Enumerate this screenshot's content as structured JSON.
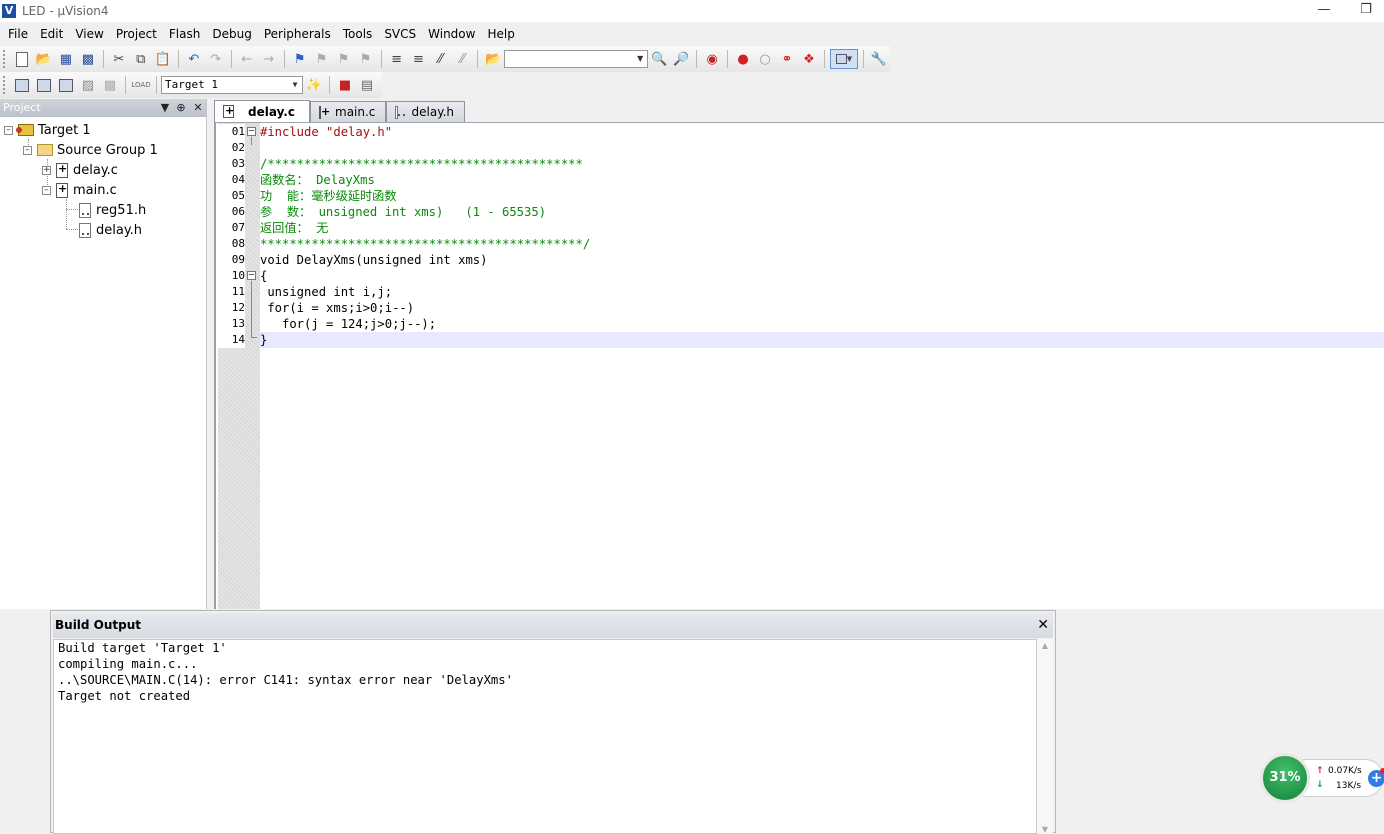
{
  "window": {
    "title": "LED  - µVision4",
    "icon": "uvision-icon"
  },
  "menu": [
    "File",
    "Edit",
    "View",
    "Project",
    "Flash",
    "Debug",
    "Peripherals",
    "Tools",
    "SVCS",
    "Window",
    "Help"
  ],
  "toolbar": {
    "target_select": "Target 1",
    "find_value": ""
  },
  "project": {
    "header": "Project",
    "tree": {
      "target": "Target 1",
      "group": "Source Group 1",
      "files": [
        "delay.c",
        "main.c"
      ],
      "headers": [
        "reg51.h",
        "delay.h"
      ]
    }
  },
  "tabs": [
    "delay.c",
    "main.c",
    "delay.h"
  ],
  "editor": {
    "line_numbers": [
      "01",
      "02",
      "03",
      "04",
      "05",
      "06",
      "07",
      "08",
      "09",
      "10",
      "11",
      "12",
      "13",
      "14"
    ],
    "lines": [
      "#include \"delay.h\"",
      "",
      "/*******************************************",
      "函数名： DelayXms",
      "功  能：毫秒级延时函数",
      "参  数： unsigned int xms)   (1 - 65535)",
      "返回值： 无",
      "********************************************/",
      "void DelayXms(unsigned int xms)",
      "{",
      " unsigned int i,j;",
      " for(i = xms;i>0;i--)",
      "   for(j = 124;j>0;j--);",
      "}"
    ]
  },
  "build_output": {
    "title": "Build Output",
    "lines": [
      "Build target 'Target 1'",
      "compiling main.c...",
      "..\\SOURCE\\MAIN.C(14): error C141: syntax error near 'DelayXms'",
      "Target not created"
    ]
  },
  "network_widget": {
    "percent": "31%",
    "up": "0.07K/s",
    "down": "13K/s"
  }
}
